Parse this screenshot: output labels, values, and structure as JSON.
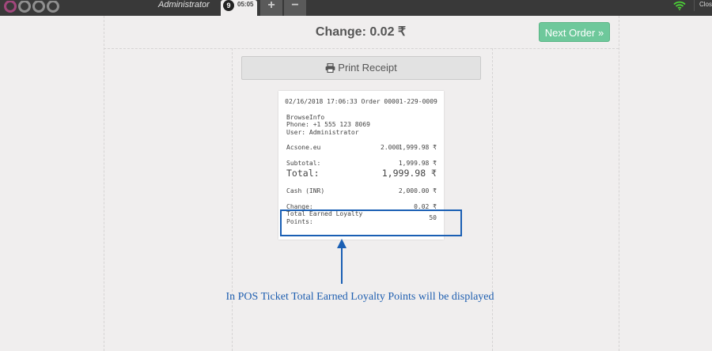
{
  "topbar": {
    "user_name": "Administrator",
    "order_number": "9",
    "order_time": "05:05",
    "add_order_label": "+",
    "remove_order_label": "−",
    "close_label": "Close"
  },
  "main": {
    "change_title": "Change: 0.02 ₹",
    "next_order_label": "Next Order »",
    "print_receipt_label": "Print Receipt"
  },
  "receipt": {
    "header": "02/16/2018 17:06:33 Order 00001-229-0009",
    "company": "BrowseInfo",
    "phone": "Phone: +1 555 123 8069",
    "user": "User: Administrator",
    "line_product": "Acsone.eu",
    "line_qty": "2.000",
    "line_price": "1,999.98 ₹",
    "subtotal_label": "Subtotal:",
    "subtotal_value": "1,999.98 ₹",
    "total_label": "Total:",
    "total_value": "1,999.98 ₹",
    "payment_label": "Cash (INR)",
    "payment_value": "2,000.00 ₹",
    "change_label": "Change:",
    "change_value": "0.02 ₹",
    "loyalty_label_line1": "Total Earned Loyalty",
    "loyalty_label_line2": "Points:",
    "loyalty_value": "50"
  },
  "annotation": {
    "caption": "In POS Ticket Total Earned Loyalty Points will be displayed",
    "color": "#1a5fb4"
  },
  "colors": {
    "topbar": "#393939",
    "next_button": "#6ec89b",
    "logo": "#a1477c"
  }
}
